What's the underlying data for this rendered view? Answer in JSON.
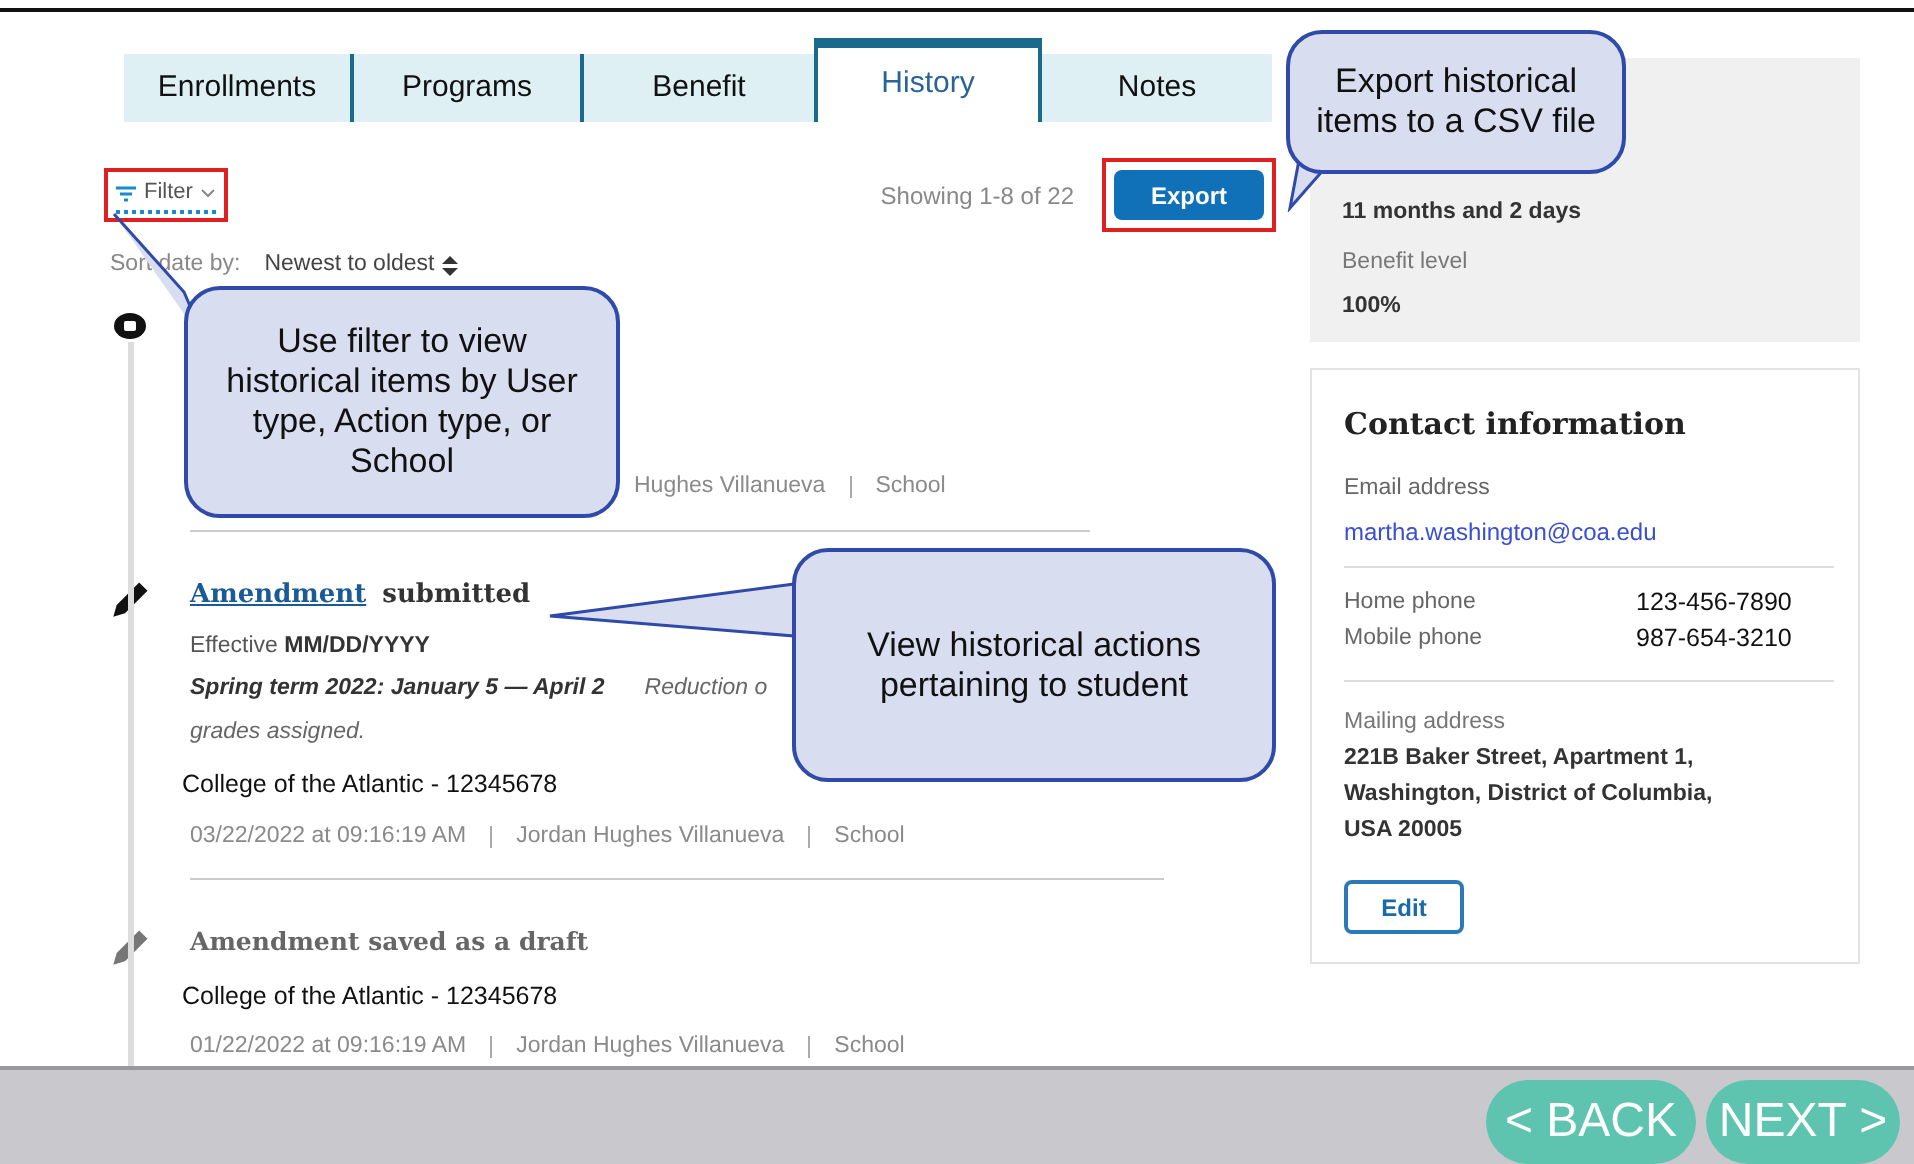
{
  "tabs": [
    {
      "label": "Enrollments",
      "selected": false
    },
    {
      "label": "Programs",
      "selected": false
    },
    {
      "label": "Benefit",
      "selected": false
    },
    {
      "label": "History",
      "selected": true
    },
    {
      "label": "Notes",
      "selected": false
    }
  ],
  "toolbar": {
    "filter": "Filter",
    "showing": "Showing 1-8 of 22",
    "export": "Export"
  },
  "sort": {
    "label": "Sort date by:",
    "value": "Newest to oldest"
  },
  "history": [
    {
      "kind": "hidden",
      "meta": [
        "Hughes Villanueva",
        "School"
      ]
    },
    {
      "kind": "full",
      "active": true,
      "link": "Amendment",
      "title": "submitted",
      "effective_label": "Effective",
      "effective_value": "MM/DD/YYYY",
      "term": "Spring term 2022: January 5 — April 2",
      "note": "Reduction o",
      "note_2": "grades assigned.",
      "school": "College of the Atlantic - 12345678",
      "meta": [
        "03/22/2022 at 09:16:19 AM",
        "Jordan Hughes Villanueva",
        "School"
      ]
    },
    {
      "kind": "short",
      "active": false,
      "title": "Amendment saved as a draft",
      "school": "College of the Atlantic - 12345678",
      "meta": [
        "01/22/2022 at 09:16:19 AM",
        "Jordan Hughes Villanueva",
        "School"
      ]
    }
  ],
  "benefit_panel": {
    "remaining": "11 months and 2 days",
    "level_label": "Benefit level",
    "level": "100%"
  },
  "contact": {
    "title": "Contact information",
    "email_label": "Email address",
    "email": "martha.washington@coa.edu",
    "phones": [
      {
        "label": "Home phone",
        "value": "123-456-7890"
      },
      {
        "label": "Mobile phone",
        "value": "987-654-3210"
      }
    ],
    "address_label": "Mailing address",
    "address_lines": [
      "221B Baker Street, Apartment 1,",
      "Washington, District of Columbia,",
      "USA 20005"
    ],
    "edit": "Edit"
  },
  "callouts": [
    {
      "text": "Export historical items to a CSV file"
    },
    {
      "text": "Use filter to view historical items by User type, Action type, or School"
    },
    {
      "text": "View historical actions pertaining to student"
    }
  ],
  "nav": {
    "back": "< BACK",
    "next": "NEXT >"
  }
}
